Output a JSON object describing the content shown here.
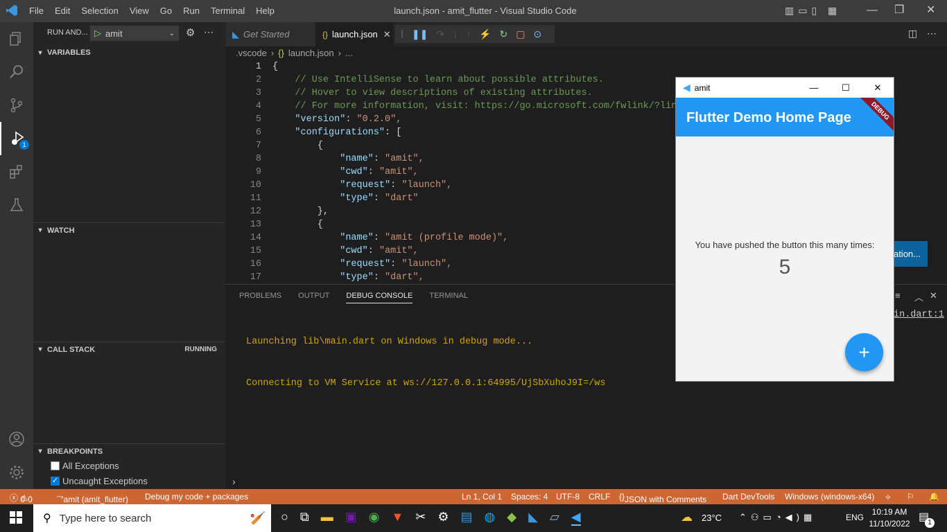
{
  "window": {
    "title": "launch.json - amit_flutter - Visual Studio Code"
  },
  "menu": [
    "File",
    "Edit",
    "Selection",
    "View",
    "Go",
    "Run",
    "Terminal",
    "Help"
  ],
  "sidebar": {
    "run_title": "RUN AND...",
    "config": "amit",
    "variables": "VARIABLES",
    "watch": "WATCH",
    "call_stack": "CALL STACK",
    "call_stack_status": "RUNNING",
    "breakpoints": "BREAKPOINTS",
    "bp_items": [
      {
        "label": "All Exceptions",
        "checked": false
      },
      {
        "label": "Uncaught Exceptions",
        "checked": true
      }
    ]
  },
  "activity": {
    "debug_badge": "1"
  },
  "tabs": [
    {
      "label": "Get Started"
    },
    {
      "label": "launch.json",
      "icon": "{}"
    }
  ],
  "breadcrumb": {
    "folder": ".vscode",
    "file": "launch.json",
    "rest": "..."
  },
  "code_lines": [
    [
      "1",
      "{"
    ],
    [
      "2",
      "    // Use IntelliSense to learn about possible attributes."
    ],
    [
      "3",
      "    // Hover to view descriptions of existing attributes."
    ],
    [
      "4",
      "    // For more information, visit: https://go.microsoft.com/fwlink/?linkid="
    ],
    [
      "5",
      "    \"version\": \"0.2.0\","
    ],
    [
      "6",
      "    \"configurations\": ["
    ],
    [
      "7",
      "        {"
    ],
    [
      "8",
      "            \"name\": \"amit\","
    ],
    [
      "9",
      "            \"cwd\": \"amit\","
    ],
    [
      "10",
      "            \"request\": \"launch\","
    ],
    [
      "11",
      "            \"type\": \"dart\""
    ],
    [
      "12",
      "        },"
    ],
    [
      "13",
      "        {"
    ],
    [
      "14",
      "            \"name\": \"amit (profile mode)\","
    ],
    [
      "15",
      "            \"cwd\": \"amit\","
    ],
    [
      "16",
      "            \"request\": \"launch\","
    ],
    [
      "17",
      "            \"type\": \"dart\","
    ]
  ],
  "panel": {
    "tabs": [
      "PROBLEMS",
      "OUTPUT",
      "DEBUG CONSOLE",
      "TERMINAL"
    ],
    "lines": [
      "Launching lib\\main.dart on Windows in debug mode...",
      "Connecting to VM Service at ws://127.0.0.1:64995/UjSbXuhoJ9I=/ws"
    ],
    "right_link": "in.dart:1",
    "partial_button": "ation..."
  },
  "status": {
    "errors": "0",
    "warnings": "0",
    "debug": "amit (amit_flutter)",
    "debug_mode": "Debug my code + packages",
    "position": "Ln 1, Col 1",
    "spaces": "Spaces: 4",
    "encoding": "UTF-8",
    "eol": "CRLF",
    "language": "JSON with Comments",
    "devtools": "Dart DevTools",
    "device": "Windows (windows-x64)"
  },
  "flutter": {
    "window_title": "amit",
    "app_title": "Flutter Demo Home Page",
    "banner": "DEBUG",
    "message": "You have pushed the button this many times:",
    "count": "5",
    "fab": "+"
  },
  "taskbar": {
    "search_placeholder": "Type here to search",
    "temp": "23°C",
    "lang": "ENG",
    "time": "10:19 AM",
    "date": "11/10/2022",
    "notif": "1"
  },
  "colors": {
    "accent": "#cc6633",
    "flutter_blue": "#2196f3",
    "vscode_blue": "#0e639c"
  }
}
